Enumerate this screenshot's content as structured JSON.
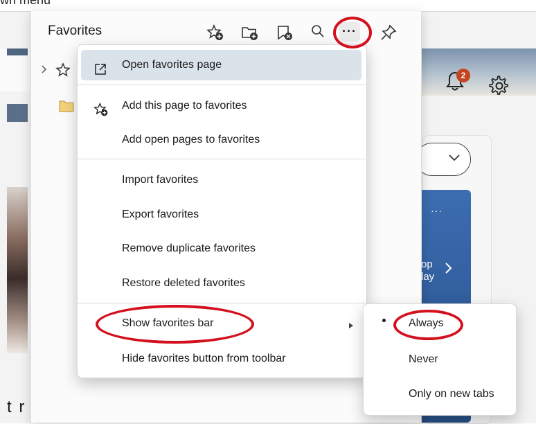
{
  "caption": "wn menu",
  "favorites": {
    "title": "Favorites",
    "header_icons": [
      "add-favorite-icon",
      "add-folder-icon",
      "delete-favorites-icon",
      "search-icon",
      "more-options-icon",
      "pin-icon"
    ]
  },
  "menu": {
    "items": [
      {
        "label": "Open favorites page",
        "icon": "open-external-icon",
        "highlighted": true
      },
      {
        "label": "Add this page to favorites",
        "icon": "add-favorite-icon"
      },
      {
        "label": "Add open pages to favorites"
      },
      {
        "label": "Import favorites"
      },
      {
        "label": "Export favorites"
      },
      {
        "label": "Remove duplicate favorites"
      },
      {
        "label": "Restore deleted favorites"
      },
      {
        "label": "Show favorites bar",
        "has_submenu": true
      },
      {
        "label": "Hide favorites button from toolbar"
      }
    ]
  },
  "submenu": {
    "selected": "Always",
    "options": [
      "Always",
      "Never",
      "Only on new tabs"
    ]
  },
  "background": {
    "notification_count": "2",
    "card_text_line1": "rop",
    "card_text_line2": "day",
    "card_more": "···",
    "bottom_text": "t r"
  },
  "annotation_color": "#d4101e"
}
